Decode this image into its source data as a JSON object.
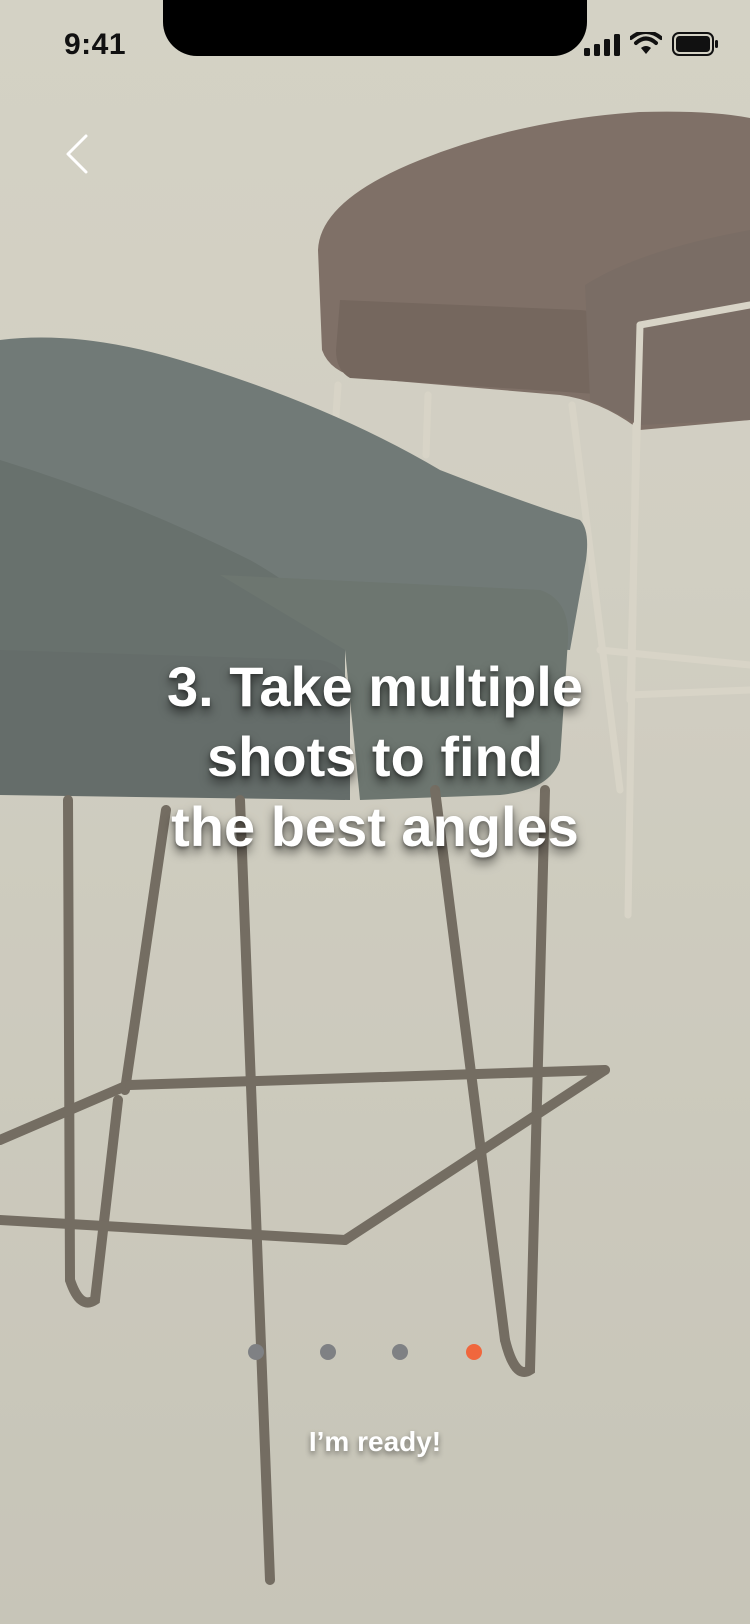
{
  "status_bar": {
    "time": "9:41",
    "icons": [
      "cellular-signal-icon",
      "wifi-icon",
      "battery-icon"
    ]
  },
  "navigation": {
    "back_icon": "chevron-left-icon"
  },
  "onboarding": {
    "headline_lines": [
      "3. Take multiple",
      "shots to find",
      "the best angles"
    ],
    "page_indicator": {
      "total": 4,
      "current": 4,
      "active_color": "#f0673d",
      "inactive_color": "#7f8184"
    },
    "cta_label": "I’m ready!"
  },
  "background": {
    "description_icon": "chairs-photo",
    "tint_color": "#cfcdc1"
  }
}
